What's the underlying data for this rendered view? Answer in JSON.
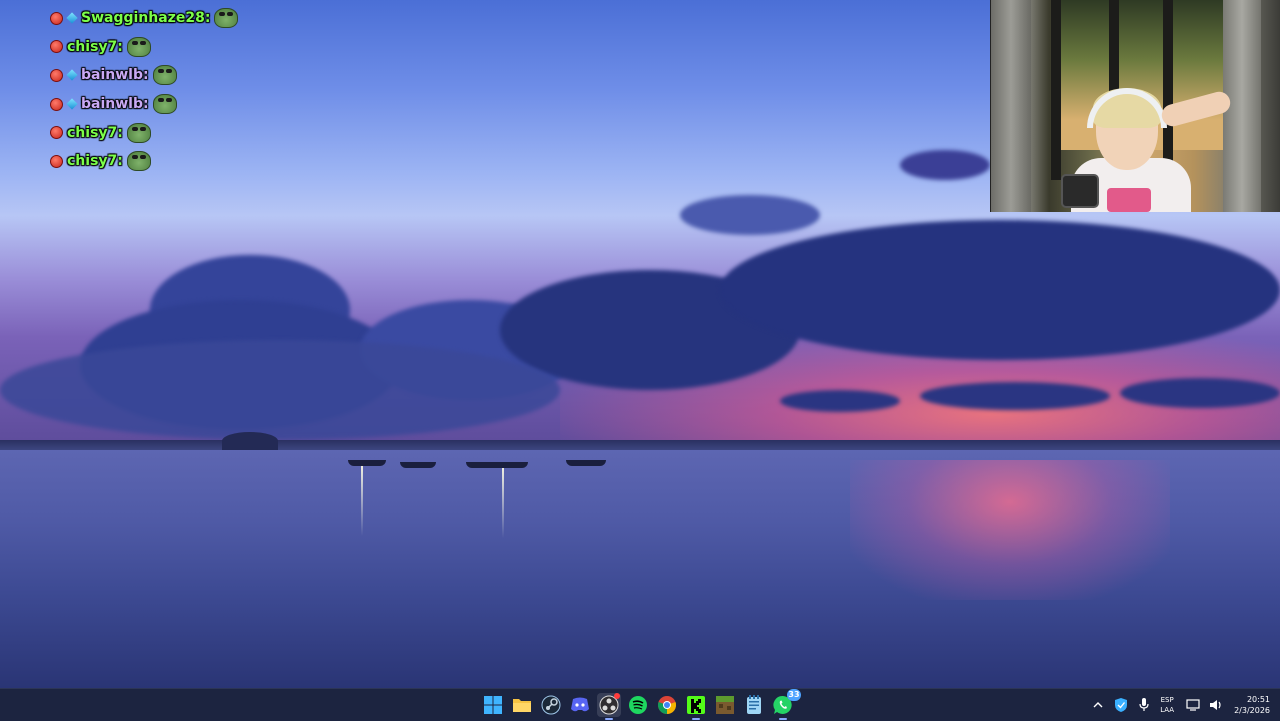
{
  "chat": {
    "messages": [
      {
        "username": "Swagginhaze28:",
        "name_color": "#7CFF4A",
        "badges": [
          "red-badge",
          "blue-badge"
        ],
        "emote": "pepe-emote"
      },
      {
        "username": "chisy7:",
        "name_color": "#7CFF4A",
        "badges": [
          "red-badge"
        ],
        "emote": "pepe-emote"
      },
      {
        "username": "bainwlb:",
        "name_color": "#C9A9F5",
        "badges": [
          "red-badge",
          "blue-badge"
        ],
        "emote": "pepe-emote"
      },
      {
        "username": "bainwlb:",
        "name_color": "#C9A9F5",
        "badges": [
          "red-badge",
          "blue-badge"
        ],
        "emote": "pepe-emote"
      },
      {
        "username": "chisy7:",
        "name_color": "#7CFF4A",
        "badges": [
          "red-badge"
        ],
        "emote": "pepe-emote"
      },
      {
        "username": "chisy7:",
        "name_color": "#7CFF4A",
        "badges": [
          "red-badge"
        ],
        "emote": "pepe-emote"
      }
    ]
  },
  "taskbar": {
    "apps": [
      {
        "name": "start-button",
        "icon": "windows-icon"
      },
      {
        "name": "file-explorer",
        "icon": "folder-icon"
      },
      {
        "name": "steam",
        "icon": "steam-icon"
      },
      {
        "name": "discord",
        "icon": "discord-icon"
      },
      {
        "name": "obs",
        "icon": "obs-icon"
      },
      {
        "name": "spotify",
        "icon": "spotify-icon"
      },
      {
        "name": "chrome",
        "icon": "chrome-icon"
      },
      {
        "name": "kick",
        "icon": "kick-icon"
      },
      {
        "name": "minecraft",
        "icon": "minecraft-icon"
      },
      {
        "name": "notepad",
        "icon": "notepad-icon"
      },
      {
        "name": "whatsapp",
        "icon": "whatsapp-icon",
        "badge": "33"
      }
    ],
    "tray": {
      "lang_top": "ESP",
      "lang_bottom": "LAA",
      "time": "20:51",
      "date": "2/3/2026"
    }
  },
  "colors": {
    "taskbar_bg": "#1C2440",
    "accent": "#88A8FF"
  }
}
